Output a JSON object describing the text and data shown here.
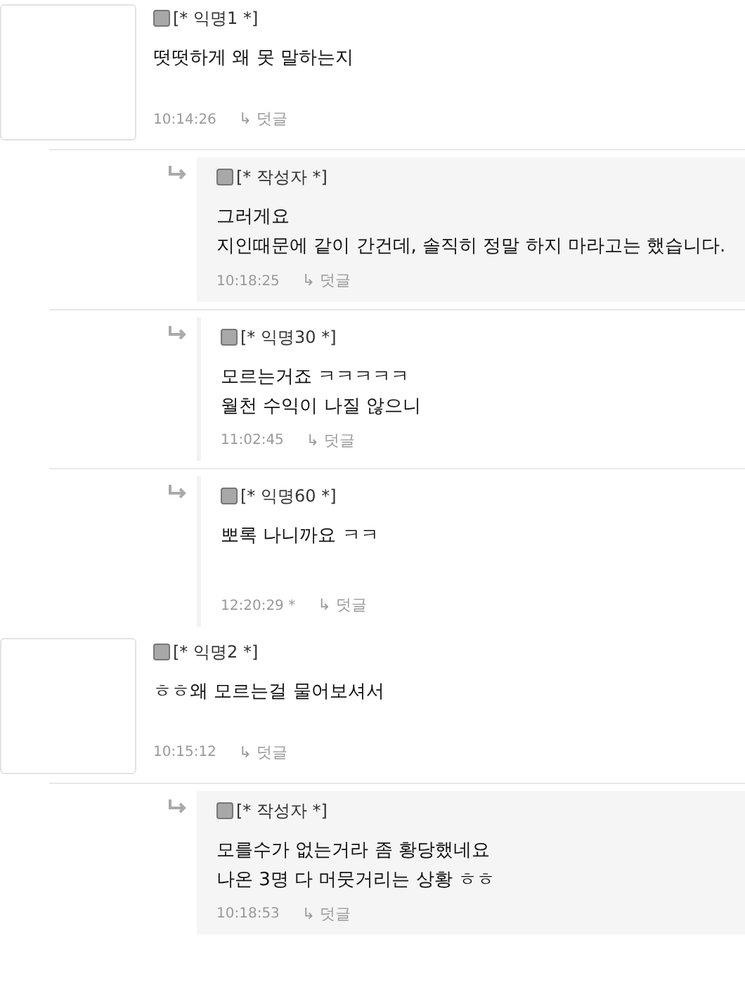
{
  "comments": [
    {
      "author": "[* 익명1 *]",
      "lines": [
        "떳떳하게 왜 못 말하는지"
      ],
      "time": "10:14:26",
      "reply_link": "↳ 덧글",
      "replies": [
        {
          "author": "[* 작성자 *]",
          "highlighted": true,
          "lines": [
            "그러게요",
            "지인때문에 같이 간건데, 솔직히 정말 하지 마라고는 했습니다."
          ],
          "time": "10:18:25",
          "reply_link": "↳ 덧글"
        },
        {
          "author": "[* 익명30 *]",
          "highlighted": false,
          "lines": [
            "모르는거죠 ㅋㅋㅋㅋㅋ",
            "월천 수익이 나질 않으니"
          ],
          "time": "11:02:45",
          "reply_link": "↳ 덧글"
        },
        {
          "author": "[* 익명60 *]",
          "highlighted": false,
          "lines": [
            "뽀록 나니까요 ㅋㅋ"
          ],
          "time": "12:20:29 *",
          "reply_link": "↳ 덧글"
        }
      ]
    },
    {
      "author": "[* 익명2 *]",
      "lines": [
        "ㅎㅎ왜 모르는걸 물어보셔서"
      ],
      "time": "10:15:12",
      "reply_link": "↳ 덧글",
      "replies": [
        {
          "author": "[* 작성자 *]",
          "highlighted": true,
          "lines": [
            "모를수가 없는거라 좀 황당했네요",
            "나온 3명 다 머뭇거리는 상황 ㅎㅎ"
          ],
          "time": "10:18:53",
          "reply_link": "↳ 덧글"
        }
      ]
    }
  ]
}
